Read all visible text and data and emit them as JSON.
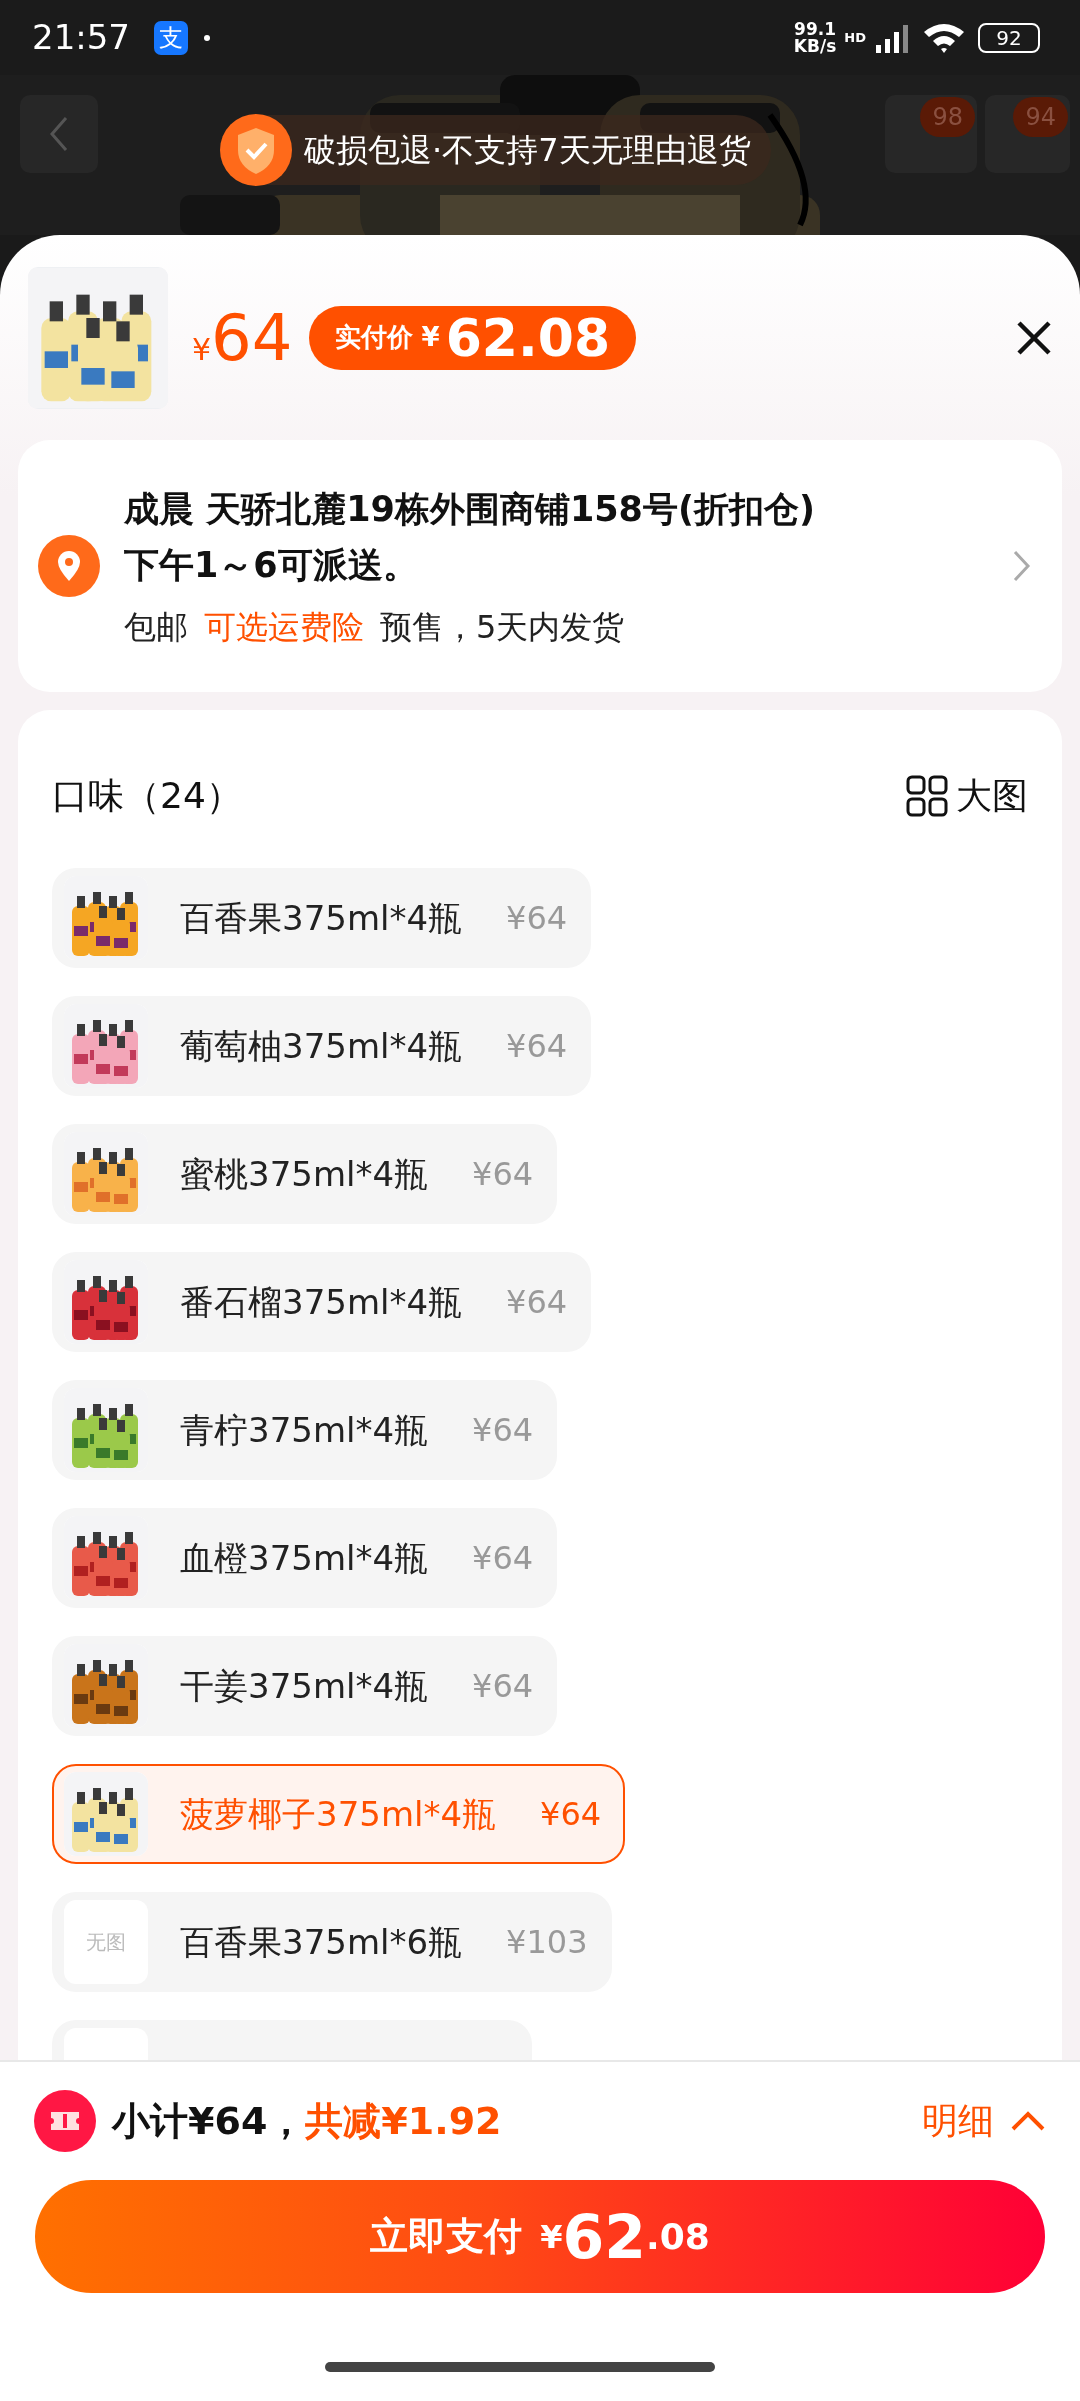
{
  "status_bar": {
    "time": "21:57",
    "app_icon": "支",
    "speed": "99.1",
    "speed_unit": "KB/s",
    "network": "HD",
    "battery": "92"
  },
  "background": {
    "kind": "picture",
    "badges": [
      "98",
      "94"
    ]
  },
  "notice": {
    "text": "破损包退·不支持7天无理由退货"
  },
  "product": {
    "currency": "¥",
    "price": "64",
    "final_label": "实付价",
    "final_currency": "¥",
    "final_price": "62.08"
  },
  "address": {
    "lines": [
      "成晨 天骄北麓19栋外围商铺158号(折扣仓)",
      "下午1～6可派送。"
    ],
    "shipping": "包邮",
    "insurance": "可选运费险",
    "delivery": "预售，5天内发货"
  },
  "options": {
    "title": "口味（24）",
    "view_toggle": "大图",
    "items": [
      {
        "label": "百香果375ml*4瓶",
        "price": "¥64",
        "selected": false,
        "kind": "picture"
      },
      {
        "label": "葡萄柚375ml*4瓶",
        "price": "¥64",
        "selected": false,
        "kind": "picture"
      },
      {
        "label": "蜜桃375ml*4瓶",
        "price": "¥64",
        "selected": false,
        "kind": "picture"
      },
      {
        "label": "番石榴375ml*4瓶",
        "price": "¥64",
        "selected": false,
        "kind": "picture"
      },
      {
        "label": "青柠375ml*4瓶",
        "price": "¥64",
        "selected": false,
        "kind": "picture"
      },
      {
        "label": "血橙375ml*4瓶",
        "price": "¥64",
        "selected": false,
        "kind": "picture"
      },
      {
        "label": "干姜375ml*4瓶",
        "price": "¥64",
        "selected": false,
        "kind": "picture"
      },
      {
        "label": "菠萝椰子375ml*4瓶",
        "price": "¥64",
        "selected": true,
        "kind": "picture"
      },
      {
        "label": "百香果375ml*6瓶",
        "price": "¥103",
        "selected": false,
        "kind": "placeholder",
        "no_image": "无图"
      },
      {
        "selected": false,
        "kind": "placeholder"
      }
    ]
  },
  "footer": {
    "subtotal": "小计¥64，",
    "discount": "共减¥1.92",
    "details": "明细",
    "pay": {
      "label": "立即支付",
      "currency": "¥",
      "integer": "62",
      ".decimals": ".08"
    }
  }
}
